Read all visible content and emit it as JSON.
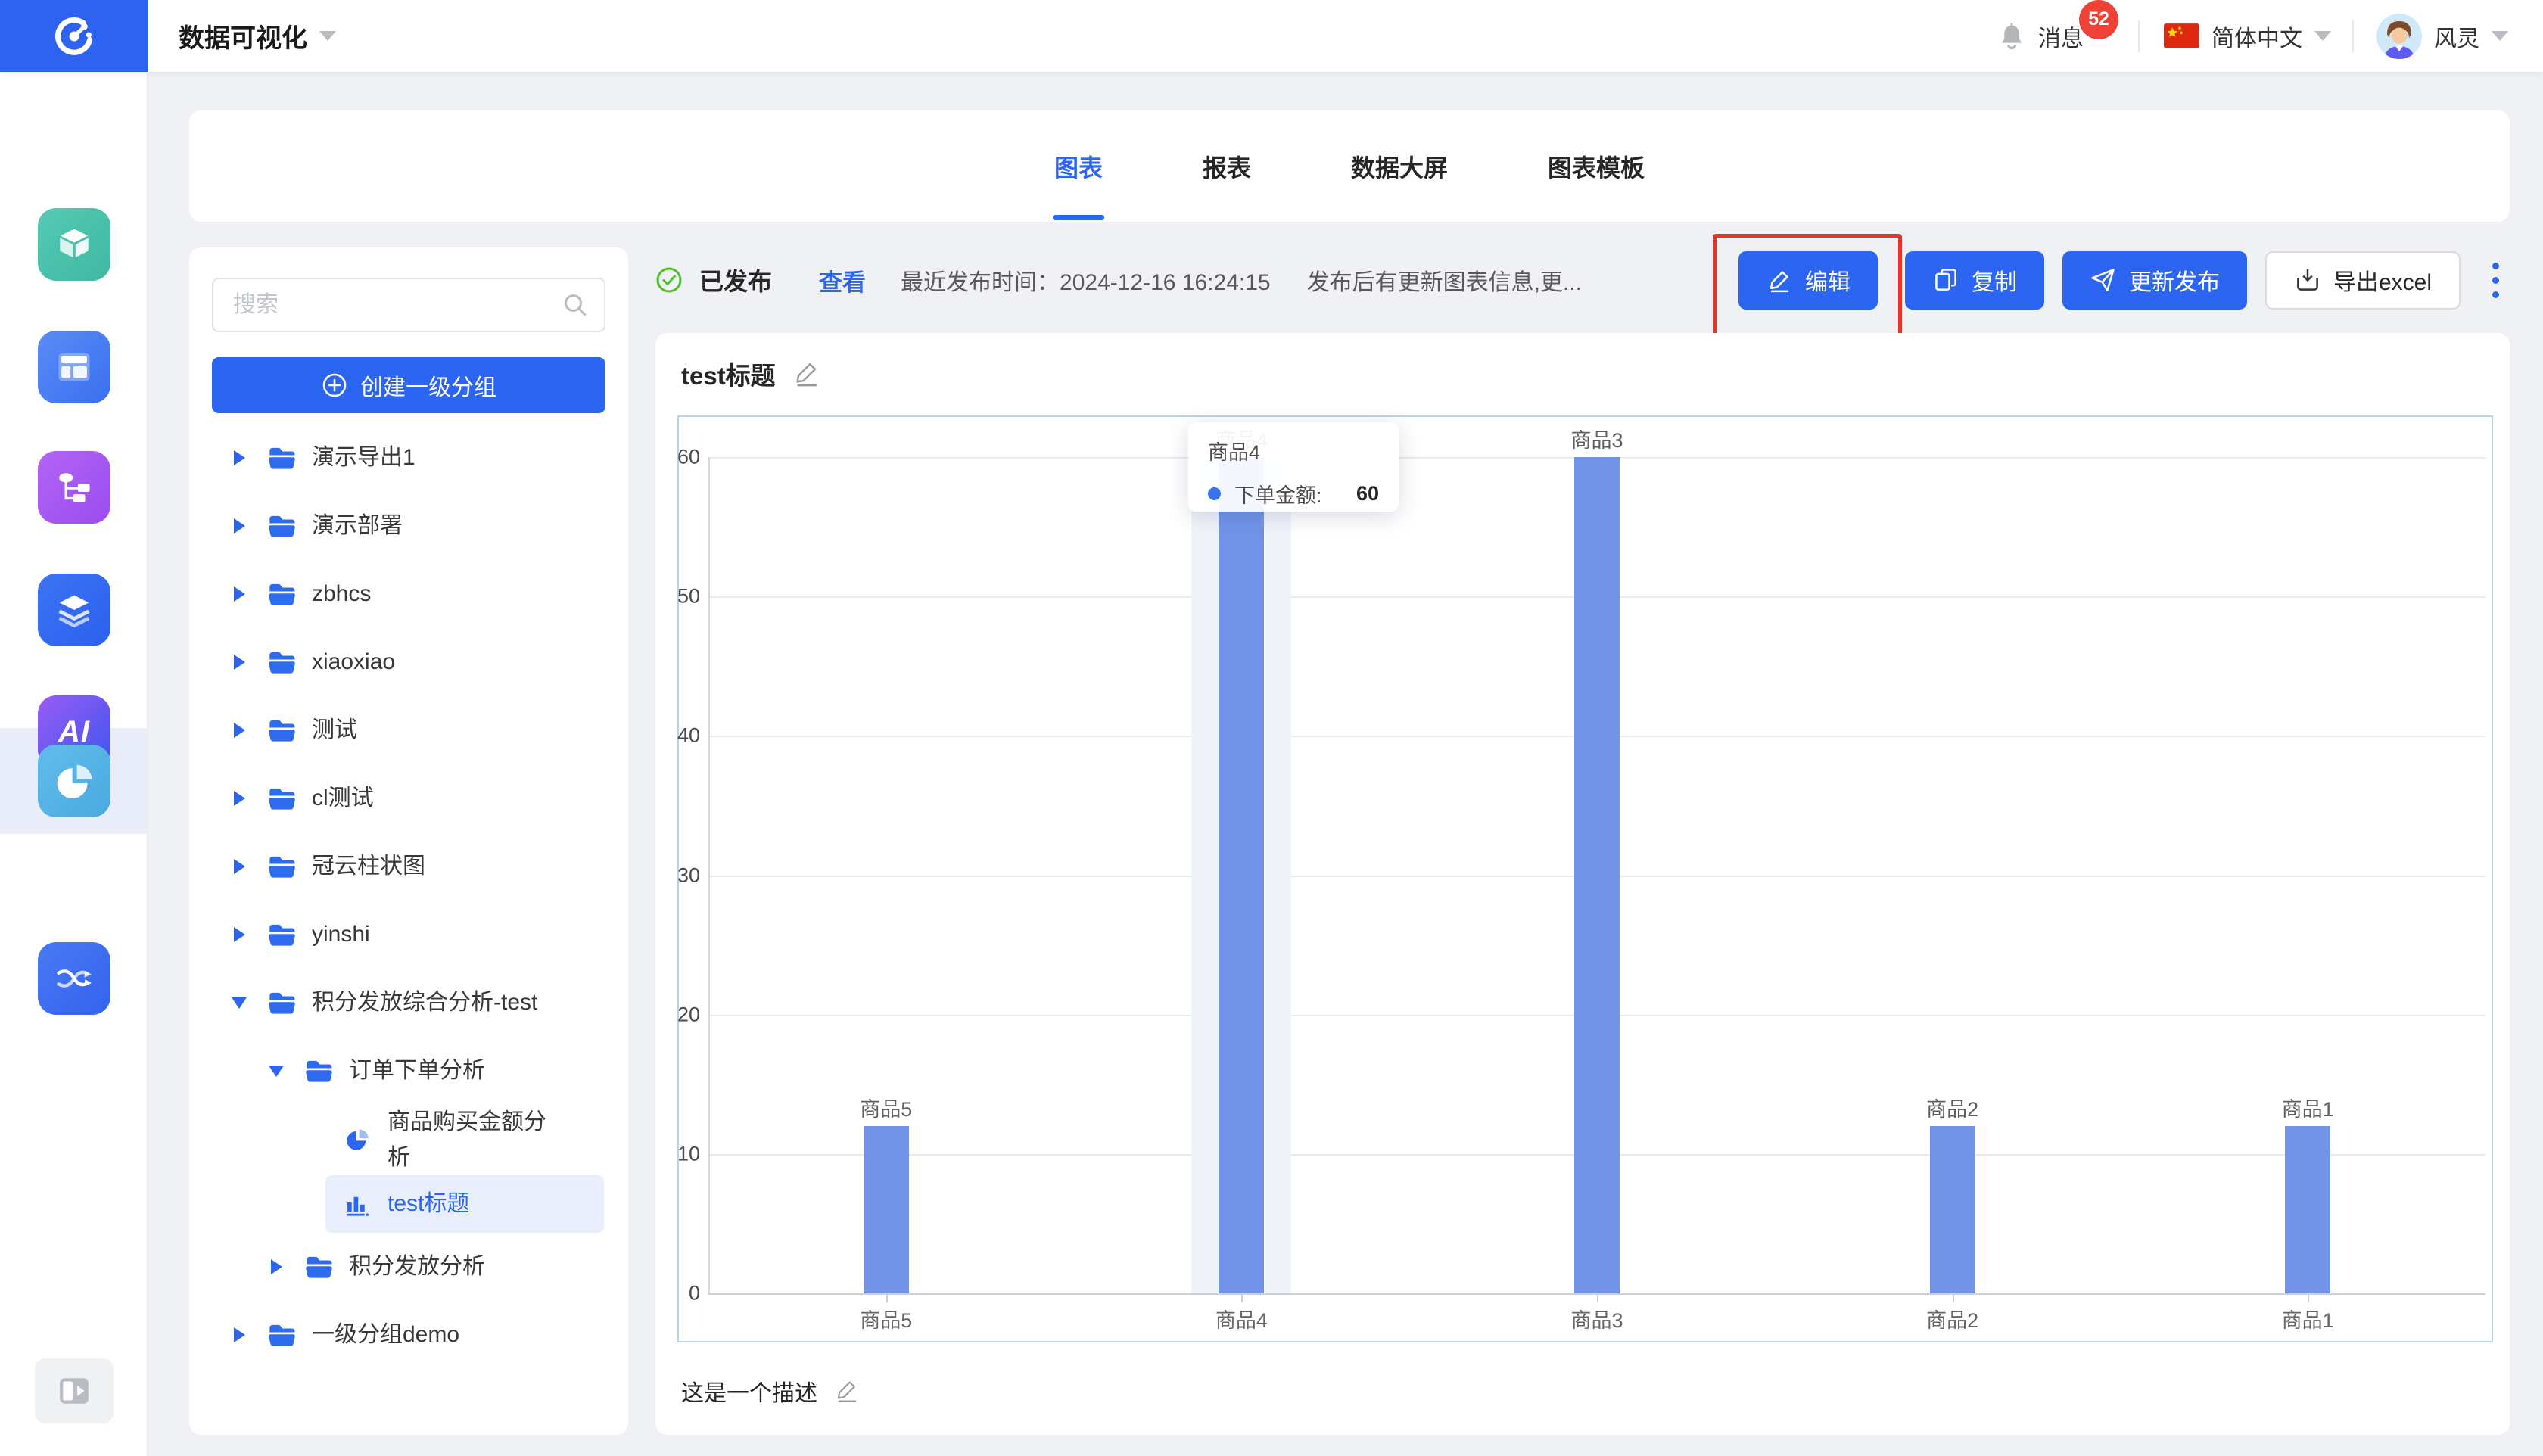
{
  "navbar": {
    "app_title": "数据可视化",
    "messages_label": "消息",
    "messages_badge": "52",
    "language_label": "简体中文",
    "username": "风灵"
  },
  "tabs": {
    "items": [
      "图表",
      "报表",
      "数据大屏",
      "图表模板"
    ],
    "active_index": 0
  },
  "sidebar": {
    "search_placeholder": "搜索",
    "create_group_label": "创建一级分组",
    "tree": [
      {
        "label": "演示导出1",
        "level": 1,
        "caret": "collapsed",
        "icon": "folder"
      },
      {
        "label": "演示部署",
        "level": 1,
        "caret": "collapsed",
        "icon": "folder"
      },
      {
        "label": "zbhcs",
        "level": 1,
        "caret": "collapsed",
        "icon": "folder"
      },
      {
        "label": "xiaoxiao",
        "level": 1,
        "caret": "collapsed",
        "icon": "folder"
      },
      {
        "label": "测试",
        "level": 1,
        "caret": "collapsed",
        "icon": "folder"
      },
      {
        "label": "cl测试",
        "level": 1,
        "caret": "collapsed",
        "icon": "folder"
      },
      {
        "label": "冠云柱状图",
        "level": 1,
        "caret": "collapsed",
        "icon": "folder"
      },
      {
        "label": "yinshi",
        "level": 1,
        "caret": "collapsed",
        "icon": "folder"
      },
      {
        "label": "积分发放综合分析-test",
        "level": 1,
        "caret": "expanded",
        "icon": "folder"
      },
      {
        "label": "订单下单分析",
        "level": 2,
        "caret": "expanded",
        "icon": "folder"
      },
      {
        "label": "商品购买金额分析",
        "level": 3,
        "caret": null,
        "icon": "pie"
      },
      {
        "label": "test标题",
        "level": 3,
        "caret": null,
        "icon": "bar",
        "selected": true
      },
      {
        "label": "积分发放分析",
        "level": 2,
        "caret": "collapsed",
        "icon": "folder"
      },
      {
        "label": "一级分组demo",
        "level": 1,
        "caret": "collapsed",
        "icon": "folder"
      }
    ]
  },
  "statusbar": {
    "status_label": "已发布",
    "view_link": "查看",
    "publish_time_text": "最近发布时间：2024-12-16 16:24:15",
    "update_note": "发布后有更新图表信息,更..."
  },
  "actions": {
    "edit": "编辑",
    "copy": "复制",
    "republish": "更新发布",
    "export_excel": "导出excel"
  },
  "chart": {
    "title": "test标题",
    "description": "这是一个描述",
    "tooltip": {
      "category": "商品4",
      "series_label": "下单金额:",
      "value": "60"
    }
  },
  "chart_data": {
    "type": "bar",
    "title": "test标题",
    "categories": [
      "商品5",
      "商品4",
      "商品3",
      "商品2",
      "商品1"
    ],
    "values": [
      12,
      60,
      60,
      12,
      12
    ],
    "series_name": "下单金额",
    "ylim": [
      0,
      60
    ],
    "yticks": [
      0,
      10,
      20,
      30,
      40,
      50,
      60
    ],
    "grid": true,
    "legend_position": "none",
    "bar_color": "#7293e8",
    "highlight_index": 1,
    "data_labels": "category_names_above_bars"
  },
  "icons": {
    "rail": [
      "cube-icon",
      "layout-icon",
      "flowchart-icon",
      "layers-icon",
      "ai-icon",
      "pie-chart-icon",
      "shuffle-icon"
    ],
    "rail_active": "pie-chart-icon"
  },
  "colors": {
    "brand_blue": "#2b65f1",
    "bar_blue": "#7293e8",
    "badge_red": "#ee4237",
    "annotation_red": "#e93526",
    "success_green": "#4fc22c",
    "page_bg": "#eff1f5"
  }
}
